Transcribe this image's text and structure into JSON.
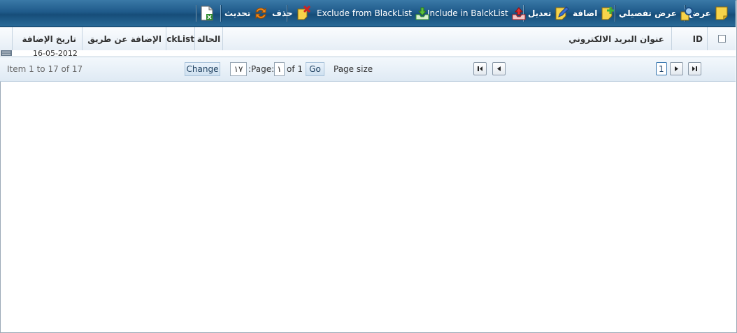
{
  "toolbar": {
    "view": "عرض",
    "details": "عرض تفصيلي",
    "add": "اضافة",
    "edit": "تعديل",
    "include": "Include in BalckList",
    "exclude": "Exclude from BlackList",
    "delete": "حذف",
    "refresh": "تحديث"
  },
  "columns": {
    "id": "ID",
    "email": "عنوان البريد الالكتروني",
    "status": "الحالة",
    "blacklist": "ckList",
    "added_by": "الإضافة عن طريق",
    "added_date": "تاريخ الإضافة"
  },
  "row": {
    "date_partial": "16-05-2012"
  },
  "pager": {
    "current_page": "1",
    "page_size_label": "Page size",
    "go": "Go",
    "of": "of 1",
    "page_label": ":Page:",
    "page_value": "١",
    "size_value": "١٧",
    "change": "Change",
    "summary": "Item 1 to 17 of 17"
  },
  "colors": {
    "toolbar": "#1f5a8a",
    "header": "#e6eef6",
    "pager": "#dfeaf4"
  }
}
